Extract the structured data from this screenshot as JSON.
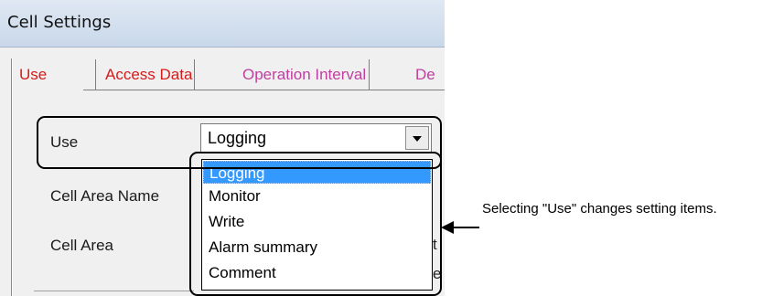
{
  "window": {
    "title": "Cell Settings"
  },
  "tabs": [
    {
      "label": "Use"
    },
    {
      "label": "Access Data"
    },
    {
      "label": "Operation Interval"
    },
    {
      "label": "De"
    }
  ],
  "form": {
    "use_label": "Use",
    "cell_area_name_label": "Cell Area Name",
    "cell_area_label": "Cell Area",
    "use_value": "Logging",
    "partial_text_1": "t",
    "partial_text_2": "e"
  },
  "dropdown": {
    "options": [
      "Logging",
      "Monitor",
      "Write",
      "Alarm summary",
      "Comment"
    ],
    "selected_index": 0
  },
  "annotation": {
    "text": "Selecting \"Use\" changes setting items."
  },
  "icons": {
    "combo_arrow": "chevron-down-icon",
    "callout_arrow": "arrow-left-icon"
  },
  "colors": {
    "tab_active": "#d61b1b",
    "tab_other": "#c03fa0",
    "selection": "#3399ff"
  }
}
